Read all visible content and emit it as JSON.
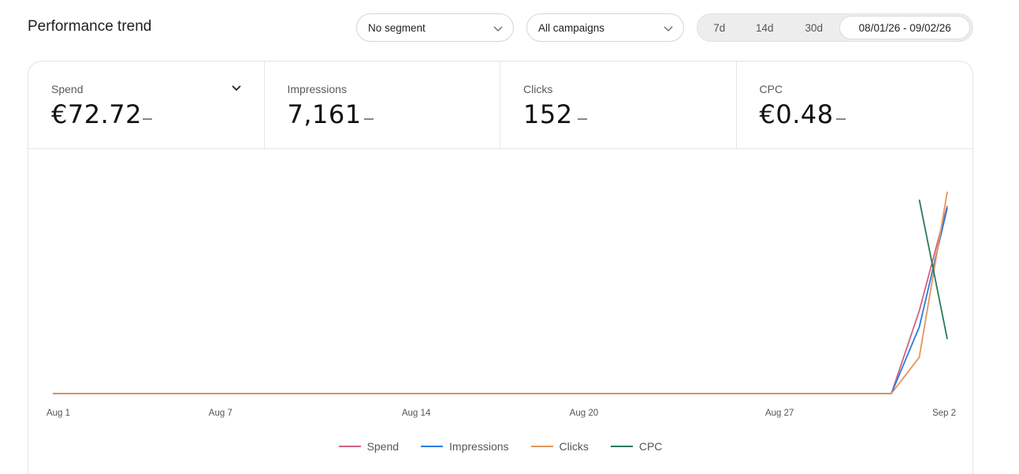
{
  "header": {
    "title": "Performance trend"
  },
  "filters": {
    "segment": "No segment",
    "campaigns": "All campaigns",
    "ranges": [
      "7d",
      "14d",
      "30d"
    ],
    "active_range": "08/01/26 - 09/02/26"
  },
  "metrics": [
    {
      "label": "Spend",
      "value": "€72.72",
      "delta": "–"
    },
    {
      "label": "Impressions",
      "value": "7,161",
      "delta": "–"
    },
    {
      "label": "Clicks",
      "value": "152",
      "delta": "–"
    },
    {
      "label": "CPC",
      "value": "€0.48",
      "delta": "–"
    }
  ],
  "chart_data": {
    "type": "line",
    "x": [
      "Aug 1",
      "Aug 2",
      "Aug 3",
      "Aug 4",
      "Aug 5",
      "Aug 6",
      "Aug 7",
      "Aug 8",
      "Aug 9",
      "Aug 10",
      "Aug 11",
      "Aug 12",
      "Aug 13",
      "Aug 14",
      "Aug 15",
      "Aug 16",
      "Aug 17",
      "Aug 18",
      "Aug 19",
      "Aug 20",
      "Aug 21",
      "Aug 22",
      "Aug 23",
      "Aug 24",
      "Aug 25",
      "Aug 26",
      "Aug 27",
      "Aug 28",
      "Aug 29",
      "Aug 30",
      "Aug 31",
      "Sep 1",
      "Sep 2"
    ],
    "tick_labels": [
      "Aug 1",
      "Aug 7",
      "Aug 14",
      "Aug 20",
      "Aug 27",
      "Sep 2"
    ],
    "tick_index": [
      0,
      6,
      13,
      19,
      26,
      32
    ],
    "series": [
      {
        "name": "Spend",
        "color": "#d0637c",
        "values": [
          0,
          0,
          0,
          0,
          0,
          0,
          0,
          0,
          0,
          0,
          0,
          0,
          0,
          0,
          0,
          0,
          0,
          0,
          0,
          0,
          0,
          0,
          0,
          0,
          0,
          0,
          0,
          0,
          0,
          0,
          0,
          0.41,
          0.93
        ]
      },
      {
        "name": "Impressions",
        "color": "#2a7be4",
        "values": [
          0,
          0,
          0,
          0,
          0,
          0,
          0,
          0,
          0,
          0,
          0,
          0,
          0,
          0,
          0,
          0,
          0,
          0,
          0,
          0,
          0,
          0,
          0,
          0,
          0,
          0,
          0,
          0,
          0,
          0,
          0,
          0.33,
          0.92
        ]
      },
      {
        "name": "Clicks",
        "color": "#e3965a",
        "values": [
          0,
          0,
          0,
          0,
          0,
          0,
          0,
          0,
          0,
          0,
          0,
          0,
          0,
          0,
          0,
          0,
          0,
          0,
          0,
          0,
          0,
          0,
          0,
          0,
          0,
          0,
          0,
          0,
          0,
          0,
          0,
          0.18,
          1.0
        ]
      },
      {
        "name": "CPC",
        "color": "#2b7a56",
        "values": [
          null,
          null,
          null,
          null,
          null,
          null,
          null,
          null,
          null,
          null,
          null,
          null,
          null,
          null,
          null,
          null,
          null,
          null,
          null,
          null,
          null,
          null,
          null,
          null,
          null,
          null,
          null,
          null,
          null,
          null,
          null,
          0.96,
          0.27
        ]
      }
    ],
    "ylim": [
      0,
      1
    ],
    "grid": false,
    "legend_position": "bottom-center"
  }
}
